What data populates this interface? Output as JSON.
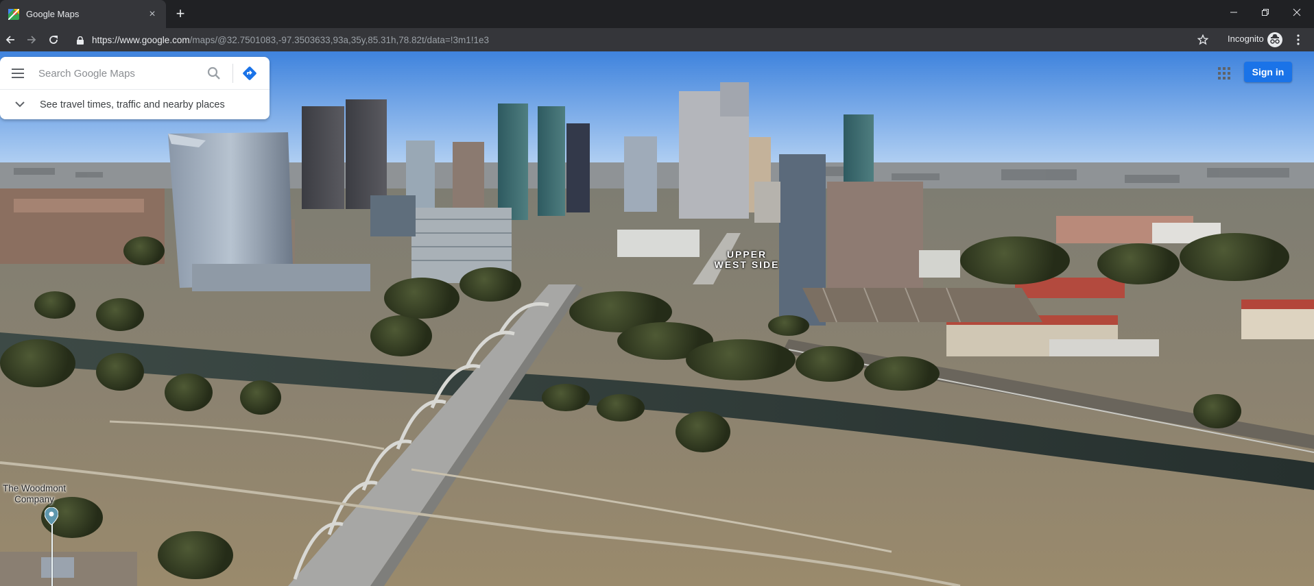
{
  "browser": {
    "tab_title": "Google Maps",
    "close_tab_glyph": "×",
    "new_tab_glyph": "+",
    "url_host": "https://www.google.com",
    "url_path": "/maps/@32.7501083,-97.3503633,93a,35y,85.31h,78.82t/data=!3m1!1e3",
    "incognito_label": "Incognito",
    "icons": {
      "back": "arrow-left-icon",
      "forward": "arrow-right-icon",
      "reload": "reload-icon",
      "lock": "lock-icon",
      "bookmark": "star-icon",
      "incognito": "incognito-icon",
      "menu": "more-vert-icon",
      "minimize": "minimize-icon",
      "restore": "restore-icon",
      "close": "close-icon"
    }
  },
  "maps": {
    "search": {
      "placeholder": "Search Google Maps",
      "value": ""
    },
    "travel_prompt": "See travel times, traffic and nearby places",
    "sign_in_label": "Sign in",
    "colors": {
      "accent": "#1a73e8",
      "directions": "#4285f4"
    }
  },
  "map_labels": {
    "neighborhood": "UPPER WEST SIDE",
    "neighborhood_line1": "UPPER",
    "neighborhood_line2": "WEST SIDE",
    "poi_line1": "The Woodmont",
    "poi_line2": "Company"
  }
}
